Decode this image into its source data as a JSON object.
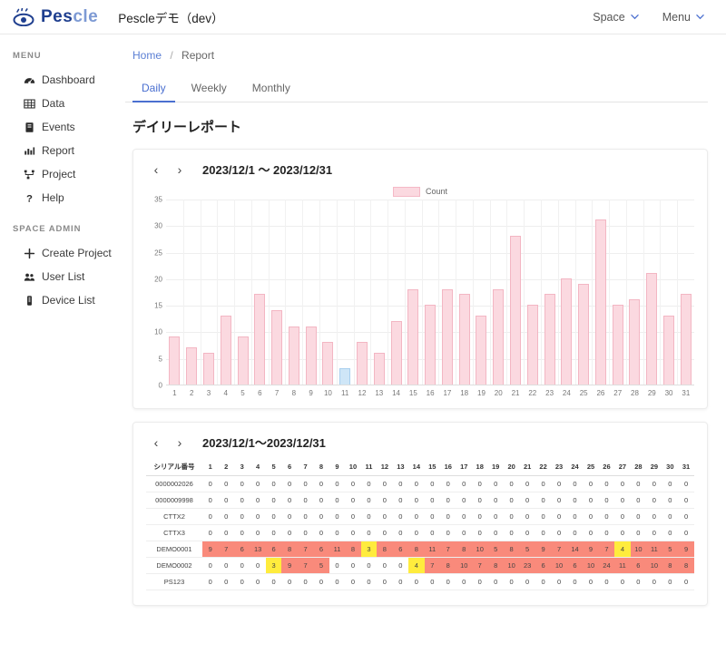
{
  "header": {
    "logo_text_1": "Pes",
    "logo_text_2": "cle",
    "logo_icon": "eye-logo-icon",
    "app_title": "Pescleデモ（dev）",
    "space_menu": "Space",
    "main_menu": "Menu"
  },
  "sidebar": {
    "group1_title": "MENU",
    "group1_items": [
      {
        "label": "Dashboard",
        "icon": "dashboard-icon"
      },
      {
        "label": "Data",
        "icon": "table-icon"
      },
      {
        "label": "Events",
        "icon": "clipboard-icon"
      },
      {
        "label": "Report",
        "icon": "bar-chart-icon"
      },
      {
        "label": "Project",
        "icon": "sitemap-icon"
      },
      {
        "label": "Help",
        "icon": "question-mark-icon"
      }
    ],
    "group2_title": "SPACE ADMIN",
    "group2_items": [
      {
        "label": "Create Project",
        "icon": "plus-icon"
      },
      {
        "label": "User List",
        "icon": "users-icon"
      },
      {
        "label": "Device List",
        "icon": "device-icon"
      }
    ]
  },
  "breadcrumb": {
    "home": "Home",
    "separator": "/",
    "current": "Report"
  },
  "tabs": [
    {
      "label": "Daily",
      "active": true
    },
    {
      "label": "Weekly",
      "active": false
    },
    {
      "label": "Monthly",
      "active": false
    }
  ],
  "page_title": "デイリーレポート",
  "chart_card": {
    "prev_label": "‹",
    "next_label": "›",
    "range": "2023/12/1 〜 2023/12/31"
  },
  "table_card": {
    "prev_label": "‹",
    "next_label": "›",
    "range": "2023/12/1〜2023/12/31"
  },
  "chart_data": {
    "type": "bar",
    "title": "",
    "xlabel": "",
    "ylabel": "",
    "ylim": [
      0,
      35
    ],
    "yticks": [
      0,
      5,
      10,
      15,
      20,
      25,
      30,
      35
    ],
    "grid": true,
    "legend": {
      "position": "top-center",
      "entries": [
        "Count"
      ]
    },
    "categories": [
      "1",
      "2",
      "3",
      "4",
      "5",
      "6",
      "7",
      "8",
      "9",
      "10",
      "11",
      "12",
      "13",
      "14",
      "15",
      "16",
      "17",
      "18",
      "19",
      "20",
      "21",
      "22",
      "23",
      "24",
      "25",
      "26",
      "27",
      "28",
      "29",
      "30",
      "31"
    ],
    "values": [
      9,
      7,
      6,
      13,
      9,
      17,
      14,
      11,
      11,
      8,
      3,
      8,
      6,
      12,
      18,
      15,
      18,
      17,
      13,
      18,
      28,
      15,
      17,
      20,
      19,
      31,
      15,
      16,
      21,
      13,
      17
    ],
    "highlight_index": 10,
    "colors": {
      "bar": "#fbd9e0",
      "bar_border": "#f3b6c3",
      "highlight": "#cfe6f7",
      "highlight_border": "#a8cfee"
    }
  },
  "table_data": {
    "type": "table",
    "first_column_header": "シリアル番号",
    "columns": [
      "1",
      "2",
      "3",
      "4",
      "5",
      "6",
      "7",
      "8",
      "9",
      "10",
      "11",
      "12",
      "13",
      "14",
      "15",
      "16",
      "17",
      "18",
      "19",
      "20",
      "21",
      "22",
      "23",
      "24",
      "25",
      "26",
      "27",
      "28",
      "29",
      "30",
      "31"
    ],
    "rows": [
      {
        "serial": "0000002026",
        "values": [
          0,
          0,
          0,
          0,
          0,
          0,
          0,
          0,
          0,
          0,
          0,
          0,
          0,
          0,
          0,
          0,
          0,
          0,
          0,
          0,
          0,
          0,
          0,
          0,
          0,
          0,
          0,
          0,
          0,
          0,
          0
        ]
      },
      {
        "serial": "0000009998",
        "values": [
          0,
          0,
          0,
          0,
          0,
          0,
          0,
          0,
          0,
          0,
          0,
          0,
          0,
          0,
          0,
          0,
          0,
          0,
          0,
          0,
          0,
          0,
          0,
          0,
          0,
          0,
          0,
          0,
          0,
          0,
          0
        ]
      },
      {
        "serial": "CTTX2",
        "values": [
          0,
          0,
          0,
          0,
          0,
          0,
          0,
          0,
          0,
          0,
          0,
          0,
          0,
          0,
          0,
          0,
          0,
          0,
          0,
          0,
          0,
          0,
          0,
          0,
          0,
          0,
          0,
          0,
          0,
          0,
          0
        ]
      },
      {
        "serial": "CTTX3",
        "values": [
          0,
          0,
          0,
          0,
          0,
          0,
          0,
          0,
          0,
          0,
          0,
          0,
          0,
          0,
          0,
          0,
          0,
          0,
          0,
          0,
          0,
          0,
          0,
          0,
          0,
          0,
          0,
          0,
          0,
          0,
          0
        ]
      },
      {
        "serial": "DEMO0001",
        "values": [
          9,
          7,
          6,
          13,
          6,
          8,
          7,
          6,
          11,
          8,
          3,
          8,
          6,
          8,
          11,
          7,
          8,
          10,
          5,
          8,
          5,
          9,
          7,
          14,
          9,
          7,
          4,
          10,
          11,
          5,
          9
        ]
      },
      {
        "serial": "DEMO0002",
        "values": [
          0,
          0,
          0,
          0,
          3,
          9,
          7,
          5,
          0,
          0,
          0,
          0,
          0,
          4,
          7,
          8,
          10,
          7,
          8,
          10,
          23,
          6,
          10,
          6,
          10,
          24,
          11,
          6,
          10,
          8,
          8
        ]
      },
      {
        "serial": "PS123",
        "values": [
          0,
          0,
          0,
          0,
          0,
          0,
          0,
          0,
          0,
          0,
          0,
          0,
          0,
          0,
          0,
          0,
          0,
          0,
          0,
          0,
          0,
          0,
          0,
          0,
          0,
          0,
          0,
          0,
          0,
          0,
          0
        ]
      }
    ],
    "highlight_yellow": {
      "DEMO0001": [
        10,
        26
      ],
      "DEMO0002": [
        4,
        13
      ]
    },
    "colors": {
      "red": "#f98a7b",
      "yellow": "#ffec3d"
    }
  }
}
